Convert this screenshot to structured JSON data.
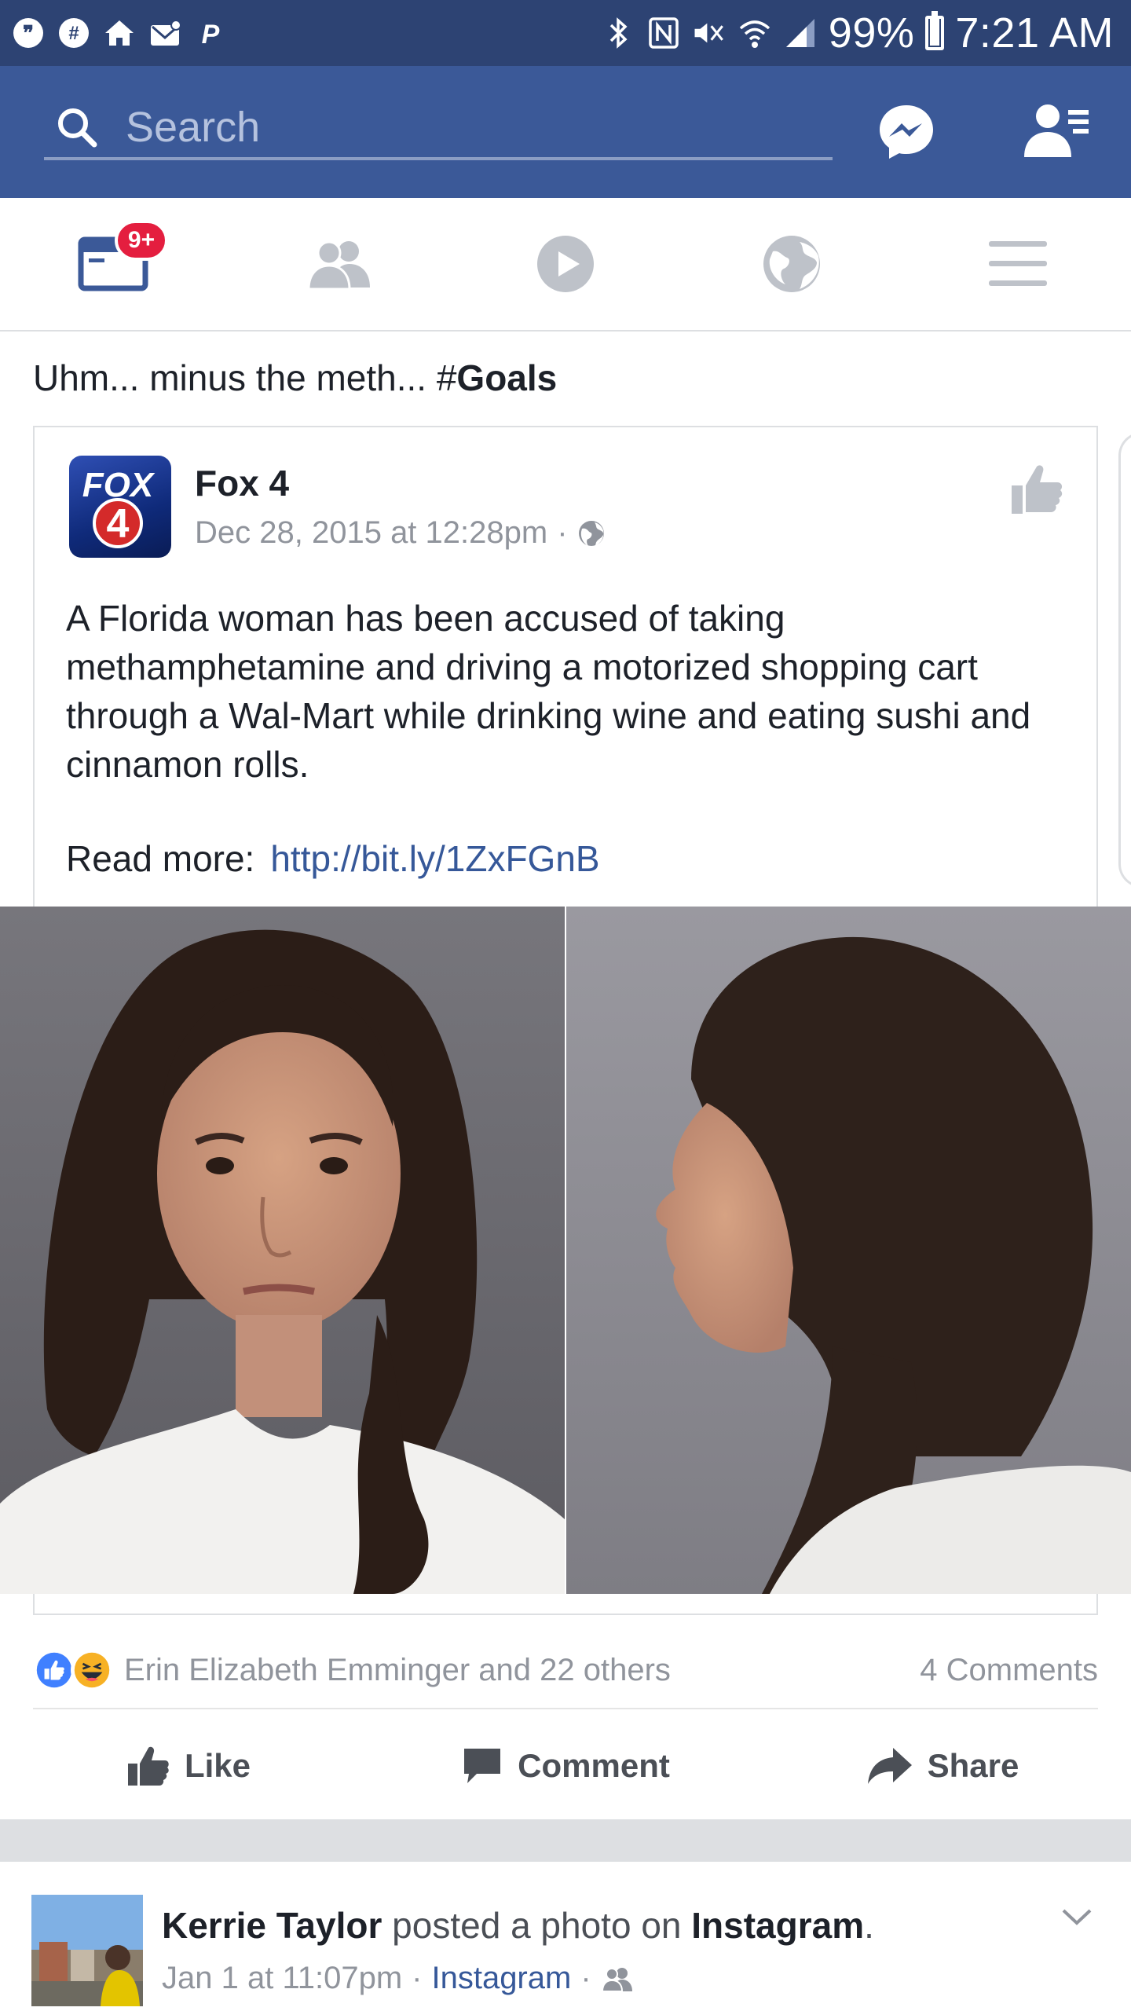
{
  "status_bar": {
    "battery": "99%",
    "time": "7:21 AM",
    "battery_level": 0.99
  },
  "search": {
    "placeholder": "Search"
  },
  "tabs": {
    "news_feed_badge": "9+"
  },
  "post": {
    "caption_prefix": "Uhm... minus the meth... #",
    "caption_hashtag": "Goals",
    "shared": {
      "page_name": "Fox 4",
      "logo_text_top": "FOX",
      "logo_text_bottom": "4",
      "timestamp": "Dec 28, 2015 at 12:28pm",
      "separator": "·",
      "body": "A Florida woman has been accused of taking methamphetamine and driving a motorized shopping cart through a Wal-Mart while drinking wine and eating sushi and cinnamon rolls.",
      "read_more_label": "Read more:",
      "read_more_link": "http://bit.ly/1ZxFGnB"
    },
    "reactions_text": "Erin Elizabeth Emminger and 22 others",
    "comments_text": "4 Comments",
    "actions": {
      "like": "Like",
      "comment": "Comment",
      "share": "Share"
    }
  },
  "next_post": {
    "author": "Kerrie Taylor",
    "action_text": "posted a photo on",
    "platform": "Instagram",
    "period": ".",
    "timestamp": "Jan 1 at 11:07pm",
    "separator": "·",
    "source": "Instagram"
  },
  "colors": {
    "facebook_blue": "#3b5998",
    "status_bar": "#2d4373",
    "badge_red": "#e41e3f",
    "link_blue": "#365899",
    "muted_gray": "#90949c"
  }
}
